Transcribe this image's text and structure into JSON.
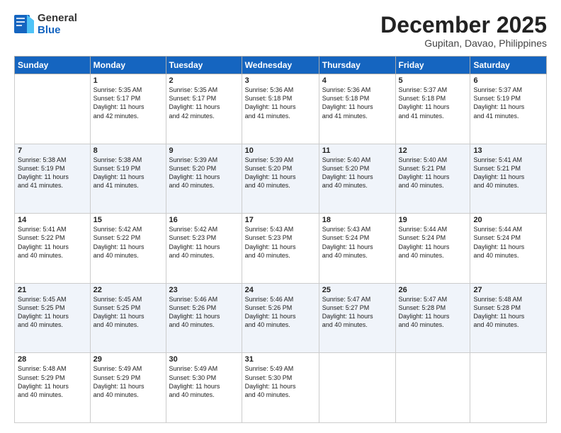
{
  "header": {
    "logo_general": "General",
    "logo_blue": "Blue",
    "month_title": "December 2025",
    "subtitle": "Gupitan, Davao, Philippines"
  },
  "days_of_week": [
    "Sunday",
    "Monday",
    "Tuesday",
    "Wednesday",
    "Thursday",
    "Friday",
    "Saturday"
  ],
  "weeks": [
    [
      {
        "day": "",
        "info": ""
      },
      {
        "day": "1",
        "info": "Sunrise: 5:35 AM\nSunset: 5:17 PM\nDaylight: 11 hours\nand 42 minutes."
      },
      {
        "day": "2",
        "info": "Sunrise: 5:35 AM\nSunset: 5:17 PM\nDaylight: 11 hours\nand 42 minutes."
      },
      {
        "day": "3",
        "info": "Sunrise: 5:36 AM\nSunset: 5:18 PM\nDaylight: 11 hours\nand 41 minutes."
      },
      {
        "day": "4",
        "info": "Sunrise: 5:36 AM\nSunset: 5:18 PM\nDaylight: 11 hours\nand 41 minutes."
      },
      {
        "day": "5",
        "info": "Sunrise: 5:37 AM\nSunset: 5:18 PM\nDaylight: 11 hours\nand 41 minutes."
      },
      {
        "day": "6",
        "info": "Sunrise: 5:37 AM\nSunset: 5:19 PM\nDaylight: 11 hours\nand 41 minutes."
      }
    ],
    [
      {
        "day": "7",
        "info": "Sunrise: 5:38 AM\nSunset: 5:19 PM\nDaylight: 11 hours\nand 41 minutes."
      },
      {
        "day": "8",
        "info": "Sunrise: 5:38 AM\nSunset: 5:19 PM\nDaylight: 11 hours\nand 41 minutes."
      },
      {
        "day": "9",
        "info": "Sunrise: 5:39 AM\nSunset: 5:20 PM\nDaylight: 11 hours\nand 40 minutes."
      },
      {
        "day": "10",
        "info": "Sunrise: 5:39 AM\nSunset: 5:20 PM\nDaylight: 11 hours\nand 40 minutes."
      },
      {
        "day": "11",
        "info": "Sunrise: 5:40 AM\nSunset: 5:20 PM\nDaylight: 11 hours\nand 40 minutes."
      },
      {
        "day": "12",
        "info": "Sunrise: 5:40 AM\nSunset: 5:21 PM\nDaylight: 11 hours\nand 40 minutes."
      },
      {
        "day": "13",
        "info": "Sunrise: 5:41 AM\nSunset: 5:21 PM\nDaylight: 11 hours\nand 40 minutes."
      }
    ],
    [
      {
        "day": "14",
        "info": "Sunrise: 5:41 AM\nSunset: 5:22 PM\nDaylight: 11 hours\nand 40 minutes."
      },
      {
        "day": "15",
        "info": "Sunrise: 5:42 AM\nSunset: 5:22 PM\nDaylight: 11 hours\nand 40 minutes."
      },
      {
        "day": "16",
        "info": "Sunrise: 5:42 AM\nSunset: 5:23 PM\nDaylight: 11 hours\nand 40 minutes."
      },
      {
        "day": "17",
        "info": "Sunrise: 5:43 AM\nSunset: 5:23 PM\nDaylight: 11 hours\nand 40 minutes."
      },
      {
        "day": "18",
        "info": "Sunrise: 5:43 AM\nSunset: 5:24 PM\nDaylight: 11 hours\nand 40 minutes."
      },
      {
        "day": "19",
        "info": "Sunrise: 5:44 AM\nSunset: 5:24 PM\nDaylight: 11 hours\nand 40 minutes."
      },
      {
        "day": "20",
        "info": "Sunrise: 5:44 AM\nSunset: 5:24 PM\nDaylight: 11 hours\nand 40 minutes."
      }
    ],
    [
      {
        "day": "21",
        "info": "Sunrise: 5:45 AM\nSunset: 5:25 PM\nDaylight: 11 hours\nand 40 minutes."
      },
      {
        "day": "22",
        "info": "Sunrise: 5:45 AM\nSunset: 5:25 PM\nDaylight: 11 hours\nand 40 minutes."
      },
      {
        "day": "23",
        "info": "Sunrise: 5:46 AM\nSunset: 5:26 PM\nDaylight: 11 hours\nand 40 minutes."
      },
      {
        "day": "24",
        "info": "Sunrise: 5:46 AM\nSunset: 5:26 PM\nDaylight: 11 hours\nand 40 minutes."
      },
      {
        "day": "25",
        "info": "Sunrise: 5:47 AM\nSunset: 5:27 PM\nDaylight: 11 hours\nand 40 minutes."
      },
      {
        "day": "26",
        "info": "Sunrise: 5:47 AM\nSunset: 5:28 PM\nDaylight: 11 hours\nand 40 minutes."
      },
      {
        "day": "27",
        "info": "Sunrise: 5:48 AM\nSunset: 5:28 PM\nDaylight: 11 hours\nand 40 minutes."
      }
    ],
    [
      {
        "day": "28",
        "info": "Sunrise: 5:48 AM\nSunset: 5:29 PM\nDaylight: 11 hours\nand 40 minutes."
      },
      {
        "day": "29",
        "info": "Sunrise: 5:49 AM\nSunset: 5:29 PM\nDaylight: 11 hours\nand 40 minutes."
      },
      {
        "day": "30",
        "info": "Sunrise: 5:49 AM\nSunset: 5:30 PM\nDaylight: 11 hours\nand 40 minutes."
      },
      {
        "day": "31",
        "info": "Sunrise: 5:49 AM\nSunset: 5:30 PM\nDaylight: 11 hours\nand 40 minutes."
      },
      {
        "day": "",
        "info": ""
      },
      {
        "day": "",
        "info": ""
      },
      {
        "day": "",
        "info": ""
      }
    ]
  ]
}
